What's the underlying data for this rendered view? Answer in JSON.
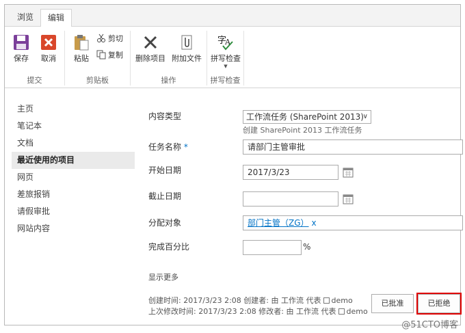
{
  "tabs": [
    {
      "label": "浏览"
    },
    {
      "label": "编辑"
    }
  ],
  "ribbon": {
    "commit": {
      "label": "提交",
      "save": "保存",
      "cancel": "取消"
    },
    "clipboard": {
      "label": "剪贴板",
      "paste": "粘贴",
      "cut": "剪切",
      "copy": "复制"
    },
    "actions": {
      "label": "操作",
      "delete": "删除项目",
      "attach": "附加文件"
    },
    "spelling": {
      "label": "拼写检查",
      "check": "拼写检查"
    }
  },
  "nav": {
    "items": [
      {
        "label": "主页"
      },
      {
        "label": "笔记本"
      },
      {
        "label": "文档"
      },
      {
        "label": "最近使用的项目"
      },
      {
        "label": "网页"
      },
      {
        "label": "差旅报销"
      },
      {
        "label": "请假审批"
      },
      {
        "label": "网站内容"
      }
    ],
    "selected_index": 3
  },
  "form": {
    "content_type": {
      "label": "内容类型",
      "value": "工作流任务 (SharePoint 2013)",
      "hint": "创建 SharePoint 2013 工作流任务"
    },
    "task_name": {
      "label": "任务名称",
      "required_mark": "*",
      "value": "请部门主管审批"
    },
    "start_date": {
      "label": "开始日期",
      "value": "2017/3/23"
    },
    "due_date": {
      "label": "截止日期",
      "value": ""
    },
    "assigned_to": {
      "label": "分配对象",
      "value": "部门主管（ZG）",
      "remove": "x"
    },
    "percent_complete": {
      "label": "完成百分比",
      "value": "",
      "unit": "%"
    },
    "show_more": "显示更多"
  },
  "meta": {
    "created": "创建时间: 2017/3/23 2:08  创建者: 由 工作流 代表",
    "created_user": "demo",
    "modified": "上次修改时间: 2017/3/23 2:08  修改者: 由 工作流 代表",
    "modified_user": "demo"
  },
  "buttons": {
    "approve": "已批准",
    "reject": "已拒绝"
  },
  "watermark": "@51CTO博客",
  "colors": {
    "accent": "#0072c6",
    "highlight": "#e00000",
    "save_purple": "#7b3f9a",
    "cancel_red": "#d9472b"
  }
}
